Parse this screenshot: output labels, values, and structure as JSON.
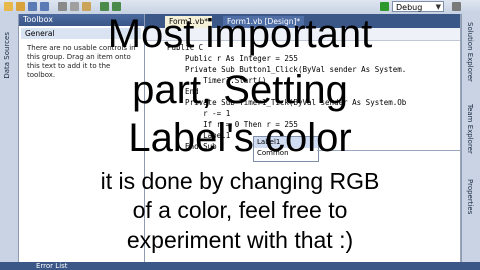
{
  "toolbar": {
    "config_label": "Debug"
  },
  "left_strip": {
    "label": "Data Sources"
  },
  "toolbox": {
    "title": "Toolbox",
    "group": "General",
    "empty_message": "There are no usable controls in this group. Drag an item onto this text to add it to the toolbox."
  },
  "editor": {
    "tabs": [
      "Form1.vb*",
      "Form1.vb [Design]*"
    ],
    "lines": [
      "Public C",
      "    Public r As Integer = 255",
      "    Private Sub Button1_Click(ByVal sender As System.",
      "        Timer1.Start()",
      "    End",
      "",
      "    Private Sub Timer1_Tick(ByVal sender As System.Ob",
      "        r -= 1",
      "        If r = 0 Then r = 255",
      "        Label1",
      "",
      "    End Sub"
    ],
    "popup_items": [
      "Label1",
      "Common"
    ]
  },
  "right_strip": {
    "labels": [
      "Solution Explorer",
      "Team Explorer",
      "Properties"
    ]
  },
  "bottom_bar": {
    "label": "Error List"
  },
  "overlay": {
    "line1": "Most important",
    "line2": "part, Setting",
    "line3": "Label's color",
    "line4": "it is done by changing RGB",
    "line5": "of a color, feel free to",
    "line6": "experiment with that :)"
  }
}
